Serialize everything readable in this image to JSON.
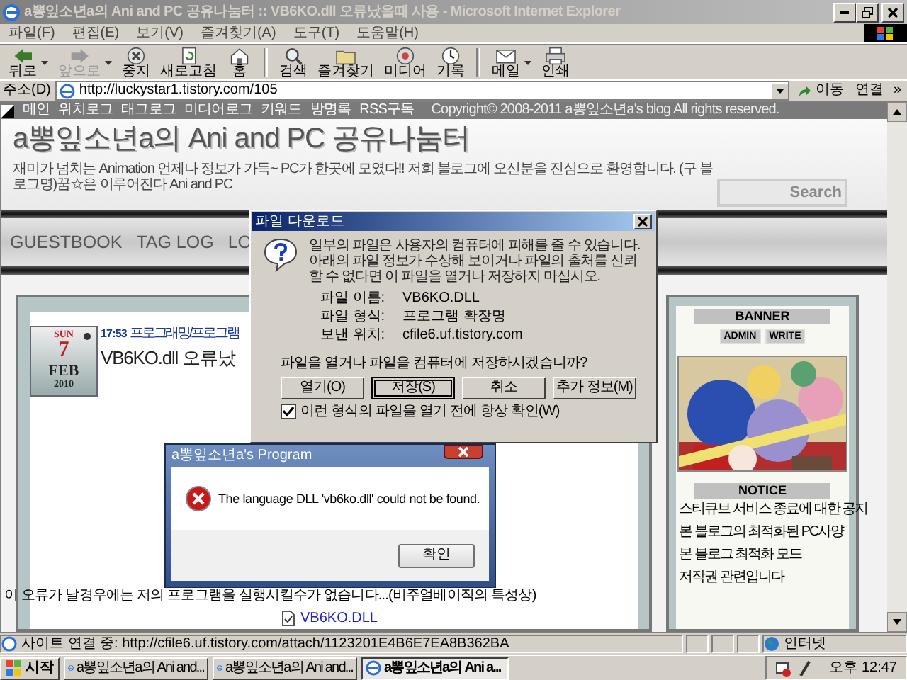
{
  "window": {
    "title": "a뽕잎소년a의 Ani and PC 공유나눔터 :: VB6KO.dll 오류났을때 사용 - Microsoft Internet Explorer",
    "active": false
  },
  "menu": [
    "파일(F)",
    "편집(E)",
    "보기(V)",
    "즐겨찾기(A)",
    "도구(T)",
    "도움말(H)"
  ],
  "toolbar": [
    {
      "kind": "back",
      "label": "뒤로",
      "disabled": false,
      "dropdown": true
    },
    {
      "kind": "forward",
      "label": "앞으로",
      "disabled": true,
      "dropdown": true
    },
    {
      "kind": "stop",
      "label": "중지",
      "disabled": false,
      "dropdown": false
    },
    {
      "kind": "refresh",
      "label": "새로고침",
      "disabled": false,
      "dropdown": false
    },
    {
      "kind": "home",
      "label": "홈",
      "disabled": false,
      "dropdown": false
    },
    {
      "kind": "search",
      "label": "검색",
      "disabled": false,
      "dropdown": false
    },
    {
      "kind": "favorites",
      "label": "즐겨찾기",
      "disabled": false,
      "dropdown": false
    },
    {
      "kind": "media",
      "label": "미디어",
      "disabled": false,
      "dropdown": false
    },
    {
      "kind": "history",
      "label": "기록",
      "disabled": false,
      "dropdown": false
    },
    {
      "kind": "mail",
      "label": "메일",
      "disabled": false,
      "dropdown": true
    },
    {
      "kind": "print",
      "label": "인쇄",
      "disabled": false,
      "dropdown": false
    }
  ],
  "address": {
    "label": "주소(D)",
    "url": "http://luckystar1.tistory.com/105",
    "go": "이동",
    "links": "연결",
    "more": "»"
  },
  "blog": {
    "nav": [
      "메인",
      "위치로그",
      "태그로그",
      "미디어로그",
      "키워드",
      "방명록",
      "RSS구독"
    ],
    "copyright": "Copyright© 2008-2011 a뽕잎소년a's blog All rights reserved.",
    "title": "a뽕잎소년a의 Ani and PC 공유나눔터",
    "tagline": "재미가 넘치는 Animation 언제나 정보가 가득~ PC가 한곳에 모였다!! 저희 블로그에 오신분을 진심으로 환영합니다. (구 블로그명)꿈☆은 이루어진다 Ani and PC",
    "search": {
      "placeholder": "Search"
    },
    "menu": [
      "GUESTBOOK",
      "TAG LOG",
      "LO"
    ],
    "post": {
      "weekday": "SUN",
      "day": "7",
      "month": "FEB",
      "year": "2010",
      "time": "17:53",
      "category": "프로그래밍/프로그램",
      "title": "VB6KO.dll 오류났",
      "body": "이 오류가 날경우에는 저의 프로그램을 실행시킬수가 없습니다...(비주얼베이직의 특성상)",
      "attachment": "VB6KO.DLL"
    },
    "sidebar": {
      "banner": "BANNER",
      "buttons": [
        "ADMIN",
        "WRITE"
      ],
      "notice": "NOTICE",
      "notices": [
        "스티큐브 서비스 종료에 대한 공지",
        "본 블로그의 최적화된 PC사양",
        "본 블로그 최적화 모드",
        "저작권 관련입니다"
      ]
    }
  },
  "status_bar": {
    "text": "사이트 연결 중: http://cfile6.uf.tistory.com/attach/1123201E4B6E7EA8B362BA",
    "zone": "인터넷"
  },
  "taskbar": {
    "start": "시작",
    "tasks": [
      {
        "label": "a뽕잎소년a의 Ani and...",
        "selected": false
      },
      {
        "label": "a뽕잎소년a의 Ani and...",
        "selected": false
      },
      {
        "label": "a뽕잎소년a의 Ani a...",
        "selected": true
      }
    ],
    "clock": "오후 12:47"
  },
  "download_dialog": {
    "title": "파일 다운로드",
    "message": "일부의 파일은 사용자의 컴퓨터에 피해를 줄 수 있습니다. 아래의 파일 정보가 수상해 보이거나 파일의 출처를 신뢰할 수 없다면 이 파일을 열거나 저장하지 마십시오.",
    "fields": [
      {
        "label": "파일 이름:",
        "value": "VB6KO.DLL"
      },
      {
        "label": "파일 형식:",
        "value": "프로그램 확장명"
      },
      {
        "label": "보낸 위치:",
        "value": "cfile6.uf.tistory.com"
      }
    ],
    "question": "파일을 열거나 파일을 컴퓨터에 저장하시겠습니까?",
    "buttons": [
      {
        "label": "열기(O)",
        "default": false
      },
      {
        "label": "저장(S)",
        "default": true
      },
      {
        "label": "취소",
        "default": false
      },
      {
        "label": "추가 정보(M)",
        "default": false
      }
    ],
    "checkbox": {
      "label": "이런 형식의 파일을 열기 전에 항상 확인(W)",
      "checked": true
    }
  },
  "error_dialog": {
    "title": "a뽕잎소년a's Program",
    "message": "The language DLL 'vb6ko.dll' could not be found.",
    "button": "확인"
  }
}
